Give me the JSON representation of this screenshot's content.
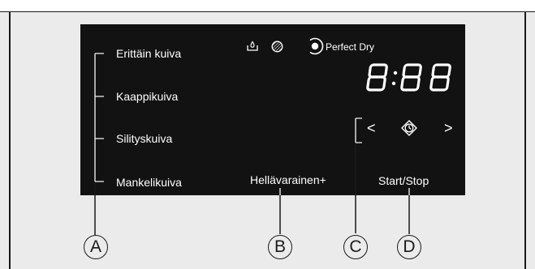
{
  "programmes": {
    "item1": "Erittäin kuiva",
    "item2": "Kaappikuiva",
    "item3": "Silityskuiva",
    "item4": "Mankelikuiva"
  },
  "options": {
    "gentle": "Hellävarainen",
    "gentle_plus": "+",
    "start_stop": "Start/Stop"
  },
  "indicators": {
    "perfect_dry": "Perfect Dry",
    "display": "8:88",
    "icons": [
      "water-container-icon",
      "filter-icon",
      "perfect-dry-icon",
      "delay-start-icon"
    ]
  },
  "navigation": {
    "left": "<",
    "right": ">"
  },
  "callouts": [
    "A",
    "B",
    "C",
    "D"
  ]
}
